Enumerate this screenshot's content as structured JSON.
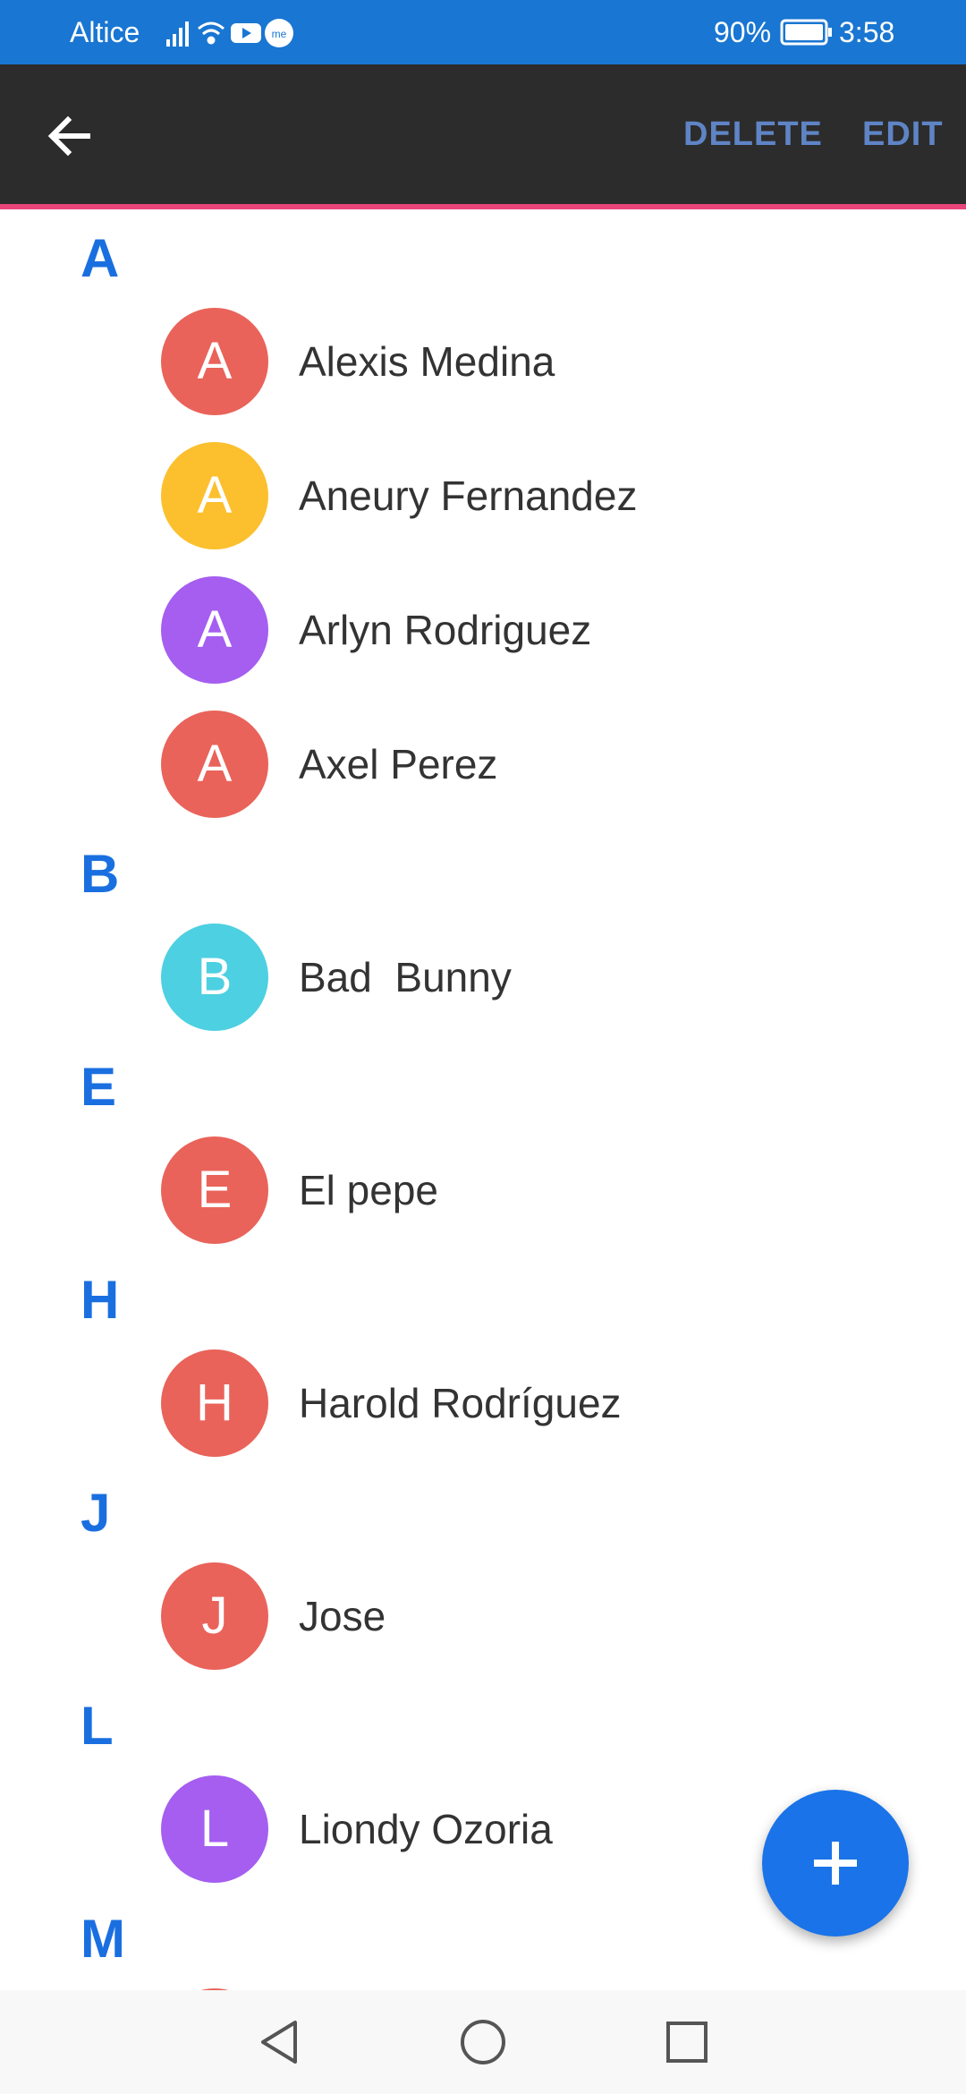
{
  "status_bar": {
    "carrier": "Altice",
    "battery_percent": "90%",
    "time": "3:58",
    "icons": [
      "signal-icon",
      "wifi-icon",
      "youtube-icon",
      "notification-icon",
      "battery-icon"
    ]
  },
  "app_bar": {
    "back_icon": "arrow-left-icon",
    "delete_label": "DELETE",
    "edit_label": "EDIT",
    "action_color": "#5f84c6",
    "accent_underline": "#e8457a"
  },
  "sections": [
    {
      "letter": "A",
      "contacts": [
        {
          "initial": "A",
          "name": "Alexis Medina",
          "color": "#e9635a"
        },
        {
          "initial": "A",
          "name": "Aneury Fernandez",
          "color": "#fcc02e"
        },
        {
          "initial": "A",
          "name": "Arlyn Rodriguez",
          "color": "#a55ef0"
        },
        {
          "initial": "A",
          "name": "Axel Perez",
          "color": "#e9635a"
        }
      ]
    },
    {
      "letter": "B",
      "contacts": [
        {
          "initial": "B",
          "name": "Bad  Bunny",
          "color": "#4dd0e1"
        }
      ]
    },
    {
      "letter": "E",
      "contacts": [
        {
          "initial": "E",
          "name": "El pepe",
          "color": "#e9635a"
        }
      ]
    },
    {
      "letter": "H",
      "contacts": [
        {
          "initial": "H",
          "name": "Harold Rodríguez",
          "color": "#e9635a"
        }
      ]
    },
    {
      "letter": "J",
      "contacts": [
        {
          "initial": "J",
          "name": "Jose",
          "color": "#e9635a"
        }
      ]
    },
    {
      "letter": "L",
      "contacts": [
        {
          "initial": "L",
          "name": "Liondy Ozoria",
          "color": "#a55ef0"
        }
      ]
    },
    {
      "letter": "M",
      "contacts": [
        {
          "initial": "",
          "name": "",
          "color": "#e9635a"
        }
      ]
    }
  ],
  "fab": {
    "icon": "plus-icon",
    "color": "#1a73e8"
  },
  "nav_bar": {
    "icons": [
      "back-triangle-icon",
      "home-circle-icon",
      "recents-square-icon"
    ]
  }
}
